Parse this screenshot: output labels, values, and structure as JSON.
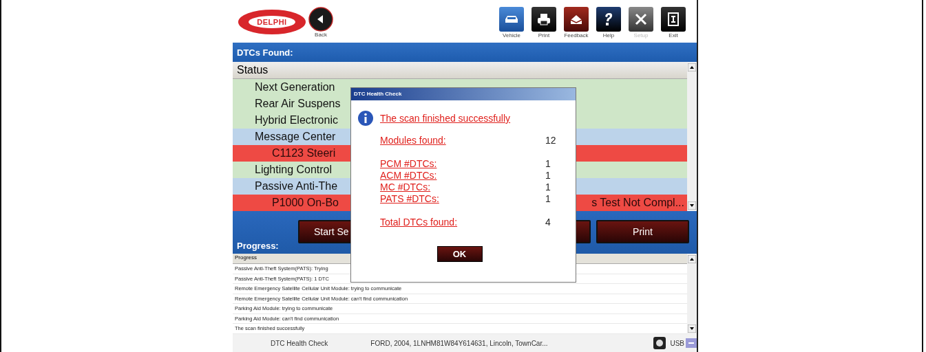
{
  "header": {
    "logo_text": "DELPHI",
    "back_label": "Back",
    "tools": [
      {
        "label": "Vehicle",
        "disabled": false
      },
      {
        "label": "Print",
        "disabled": false
      },
      {
        "label": "Feedback",
        "disabled": false
      },
      {
        "label": "Help",
        "disabled": false
      },
      {
        "label": "Setup",
        "disabled": true
      },
      {
        "label": "Exit",
        "disabled": false
      }
    ]
  },
  "section_title": "DTCs Found:",
  "table": {
    "column": "Status",
    "rows": [
      {
        "kind": "module",
        "color": "#cfe6c8",
        "text": "Next Generation"
      },
      {
        "kind": "module",
        "color": "#cfe6c8",
        "text": "Rear Air Suspens"
      },
      {
        "kind": "module",
        "color": "#cfe6c8",
        "text": "Hybrid Electronic"
      },
      {
        "kind": "module",
        "color": "#bcd3ea",
        "text": "Message Center"
      },
      {
        "kind": "dtc",
        "color": "#ee4a44",
        "text": "C1123  Steeri"
      },
      {
        "kind": "module",
        "color": "#cfe6c8",
        "text": "Lighting Control"
      },
      {
        "kind": "module",
        "color": "#bcd3ea",
        "text": "Passive Anti-The"
      },
      {
        "kind": "dtc",
        "color": "#ee4a44",
        "text": "P1000  On-Bo",
        "trailing_text": "s Test Not Compl..."
      }
    ]
  },
  "actions": {
    "start_label": "Start Se",
    "print_label": "Print"
  },
  "progress": {
    "title": "Progress:",
    "column": "Progress",
    "lines": [
      "Passive Anti-Theft System(PATS): Trying",
      "Passive Anti-Theft System(PATS): 1 DTC",
      "Remote Emergency Satellite Cellular Unit Module: trying to communicate",
      "Remote Emergency Satellite Cellular Unit Module: can't find communication",
      "Parking Aid Module: trying to communicate",
      "Parking Aid Module: can't find communication",
      "The scan finished successfully"
    ]
  },
  "status_bar": {
    "mode": "DTC Health Check",
    "vehicle": "FORD,  2004,  1LNHM81W84Y614631,  Lincoln,  TownCar...",
    "connection": "USB"
  },
  "dialog": {
    "title": "DTC Health Check",
    "message": "The scan finished successfully",
    "groups": [
      [
        {
          "label": "Modules found:",
          "value": "12"
        }
      ],
      [
        {
          "label": "PCM #DTCs:",
          "value": "1"
        },
        {
          "label": "ACM #DTCs:",
          "value": "1"
        },
        {
          "label": "MC #DTCs:",
          "value": "1"
        },
        {
          "label": "PATS #DTCs:",
          "value": "1"
        }
      ],
      [
        {
          "label": "Total DTCs found:",
          "value": "4"
        }
      ]
    ],
    "ok_label": "OK"
  }
}
